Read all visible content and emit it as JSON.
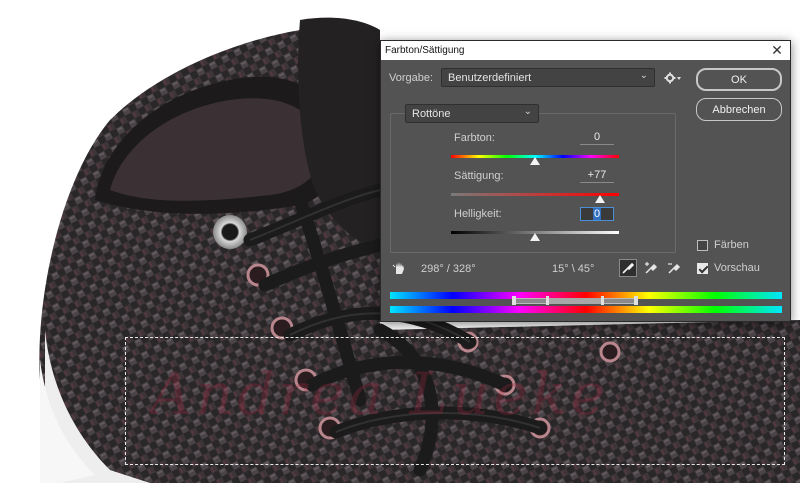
{
  "dialog": {
    "title": "Farbton/Sättigung",
    "close_icon": "close-icon",
    "preset_label": "Vorgabe:",
    "preset_value": "Benutzerdefiniert",
    "ok_label": "OK",
    "cancel_label": "Abbrechen",
    "channel_value": "Rottöne",
    "hue": {
      "label": "Farbton:",
      "value": "0",
      "slider_fraction": 0.5
    },
    "saturation": {
      "label": "Sättigung:",
      "value": "+77",
      "slider_fraction": 0.885
    },
    "lightness": {
      "label": "Helligkeit:",
      "value": "0",
      "slider_fraction": 0.5
    },
    "colorize_label": "Färben",
    "colorize_checked": false,
    "preview_label": "Vorschau",
    "preview_checked": true,
    "range_left": "298° / 328°",
    "range_right": "15° \\ 45°"
  },
  "colors": {
    "dialog_bg": "#535353",
    "accent": "#4d8fd6"
  }
}
